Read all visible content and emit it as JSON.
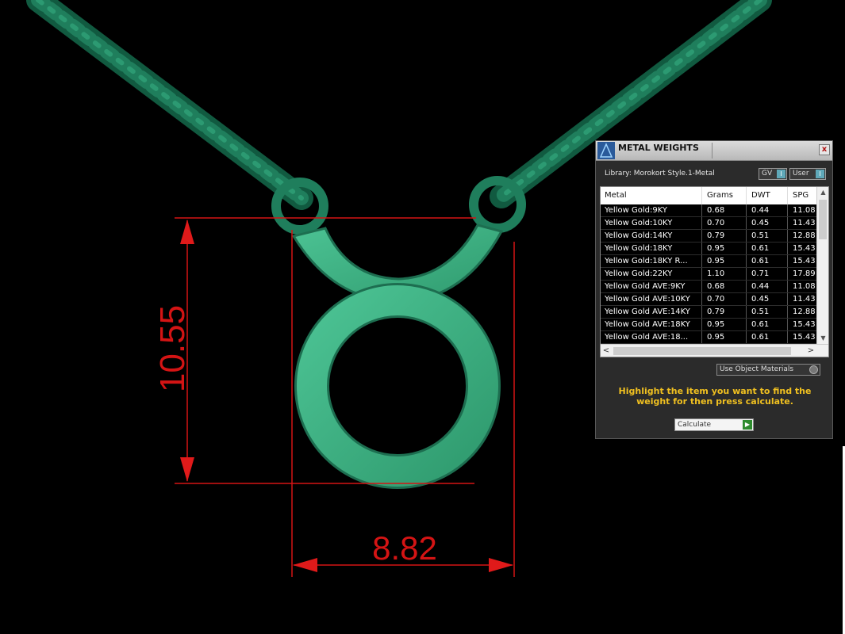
{
  "viewport": {
    "dimension_height": "10.55",
    "dimension_width": "8.82",
    "colors": {
      "background": "#000000",
      "metal": "#3aaa7c",
      "chain": "#1f7e5c",
      "dimension": "#d41414"
    }
  },
  "panel": {
    "title": "METAL WEIGHTS",
    "close_label": "x",
    "library_label": "Library: Morokort Style.1-Metal",
    "gv_label": "GV",
    "user_label": "User",
    "columns": [
      "Metal",
      "Grams",
      "DWT",
      "SPG"
    ],
    "rows": [
      {
        "metal": "Yellow Gold:9KY",
        "grams": "0.68",
        "dwt": "0.44",
        "spg": "11.08"
      },
      {
        "metal": "Yellow Gold:10KY",
        "grams": "0.70",
        "dwt": "0.45",
        "spg": "11.43"
      },
      {
        "metal": "Yellow Gold:14KY",
        "grams": "0.79",
        "dwt": "0.51",
        "spg": "12.88"
      },
      {
        "metal": "Yellow Gold:18KY",
        "grams": "0.95",
        "dwt": "0.61",
        "spg": "15.43"
      },
      {
        "metal": "Yellow Gold:18KY R...",
        "grams": "0.95",
        "dwt": "0.61",
        "spg": "15.43"
      },
      {
        "metal": "Yellow Gold:22KY",
        "grams": "1.10",
        "dwt": "0.71",
        "spg": "17.89"
      },
      {
        "metal": "Yellow Gold AVE:9KY",
        "grams": "0.68",
        "dwt": "0.44",
        "spg": "11.08"
      },
      {
        "metal": "Yellow Gold AVE:10KY",
        "grams": "0.70",
        "dwt": "0.45",
        "spg": "11.43"
      },
      {
        "metal": "Yellow Gold AVE:14KY",
        "grams": "0.79",
        "dwt": "0.51",
        "spg": "12.88"
      },
      {
        "metal": "Yellow Gold AVE:18KY",
        "grams": "0.95",
        "dwt": "0.61",
        "spg": "15.43"
      },
      {
        "metal": "Yellow Gold AVE:18...",
        "grams": "0.95",
        "dwt": "0.61",
        "spg": "15.43"
      }
    ],
    "use_object_materials_label": "Use Object Materials",
    "hint_text": "Highlight the item you want to find the weight for then press calculate.",
    "calculate_label": "Calculate",
    "colors": {
      "hint": "#f0c020",
      "toggle_accent": "#5fa8b8",
      "calc_accent": "#2e8b2e"
    }
  }
}
